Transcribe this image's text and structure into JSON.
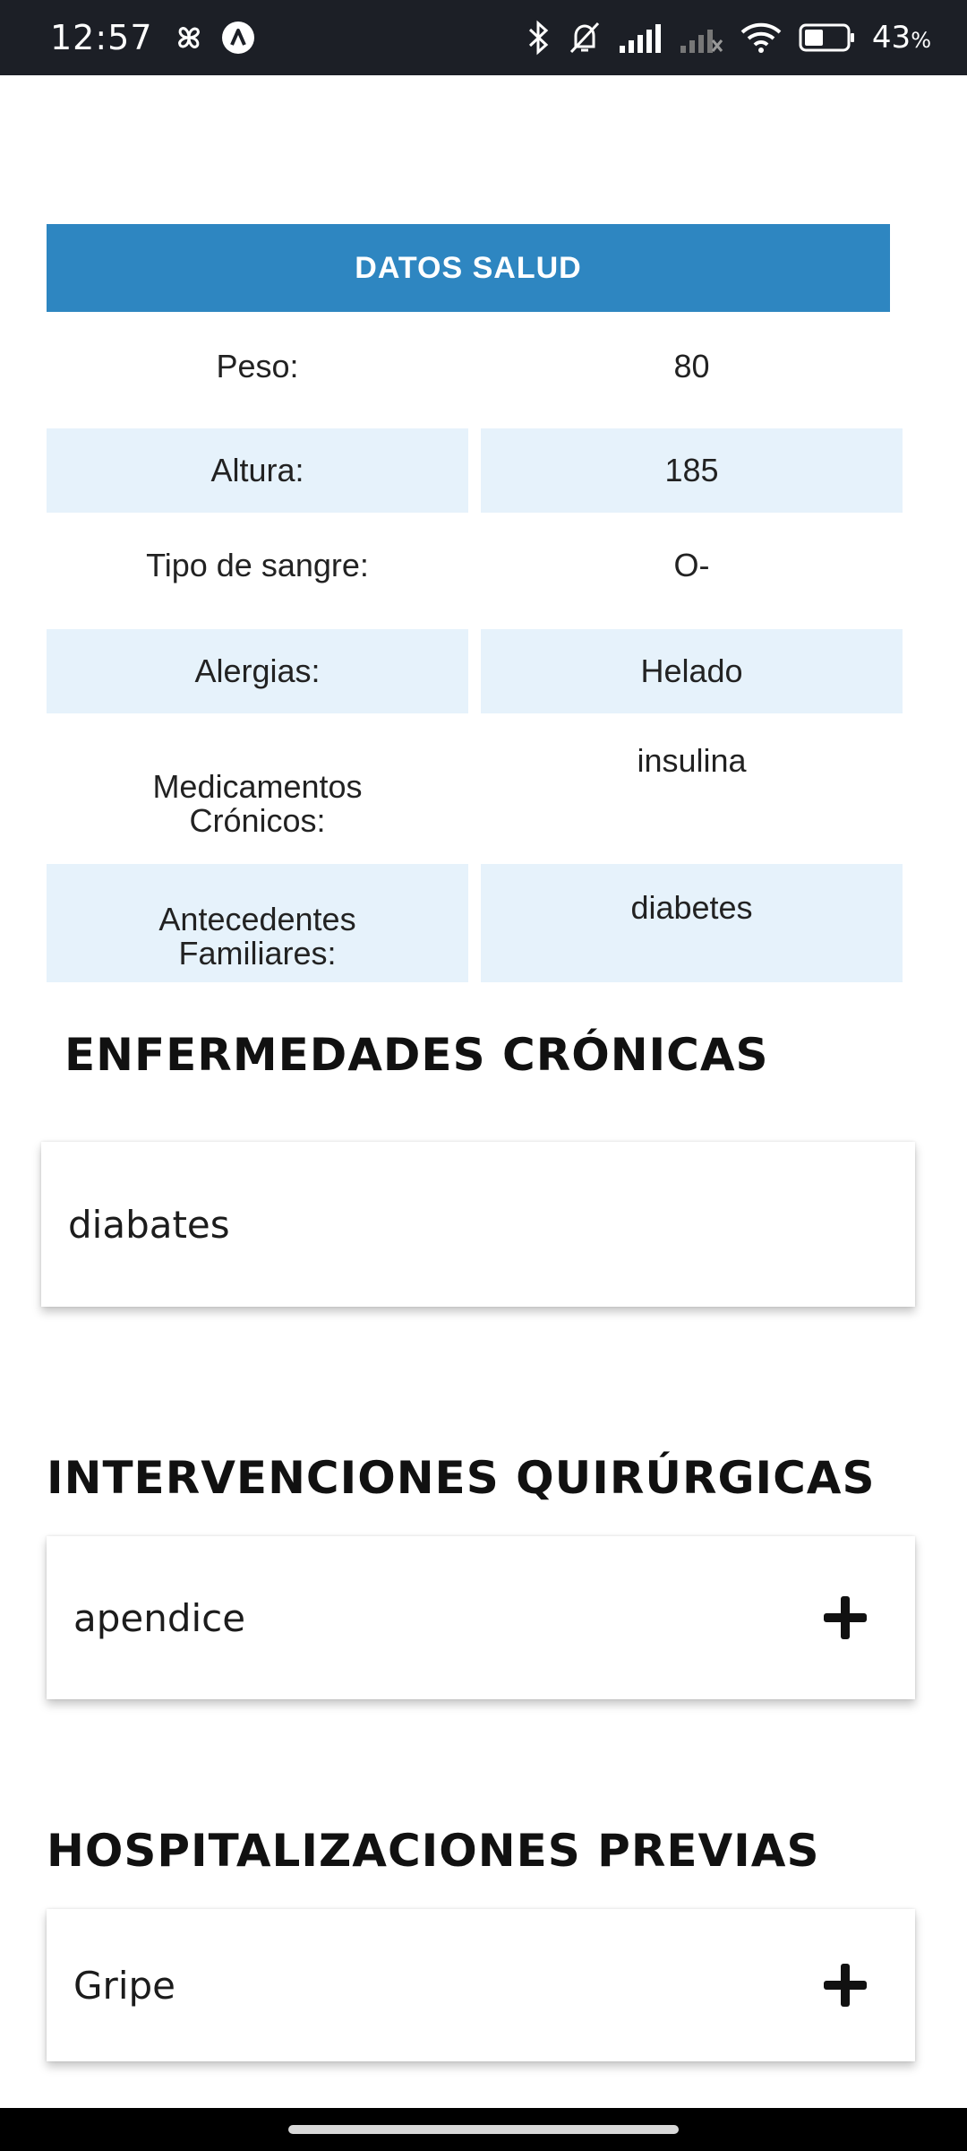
{
  "status_bar": {
    "time": "12:57",
    "battery_percent": "43",
    "battery_unit": "%",
    "battery_level": 0.43,
    "left_icons": [
      "fan-icon",
      "a-circle-icon"
    ],
    "right_icons": [
      "bluetooth-icon",
      "bell-off-icon",
      "signal-icon",
      "signal-off-icon",
      "wifi-icon",
      "battery-icon"
    ]
  },
  "health": {
    "title": "DATOS SALUD",
    "rows": [
      {
        "label": "Peso:",
        "value": "80"
      },
      {
        "label": "Altura:",
        "value": "185"
      },
      {
        "label": "Tipo de sangre:",
        "value": "O-"
      },
      {
        "label": "Alergias:",
        "value": "Helado"
      },
      {
        "label_line1": "Medicamentos",
        "label_line2": "Crónicos:",
        "value": "insulina"
      },
      {
        "label_line1": "Antecedentes",
        "label_line2": "Familiares:",
        "value": "diabetes"
      }
    ]
  },
  "chronic": {
    "title": "ENFERMEDADES CRÓNICAS",
    "items": [
      "diabates"
    ]
  },
  "surgeries": {
    "title": "INTERVENCIONES QUIRÚRGICAS",
    "items": [
      "apendice"
    ]
  },
  "hospitalizations": {
    "title": "HOSPITALIZACIONES PREVIAS",
    "items": [
      "Gripe"
    ]
  },
  "colors": {
    "accent": "#2e86c1",
    "row_shade": "#e6f2fb"
  }
}
